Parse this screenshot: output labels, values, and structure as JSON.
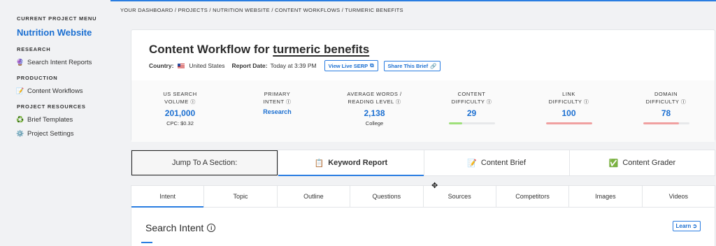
{
  "sidebar": {
    "menu_header": "CURRENT PROJECT MENU",
    "project_name": "Nutrition Website",
    "sections": [
      {
        "title": "RESEARCH",
        "items": [
          {
            "label": "Search Intent Reports",
            "icon": "crystal-ball-icon"
          }
        ]
      },
      {
        "title": "PRODUCTION",
        "items": [
          {
            "label": "Content Workflows",
            "icon": "memo-icon"
          }
        ]
      },
      {
        "title": "PROJECT RESOURCES",
        "items": [
          {
            "label": "Brief Templates",
            "icon": "recycle-icon"
          },
          {
            "label": "Project Settings",
            "icon": "gear-icon"
          }
        ]
      }
    ]
  },
  "breadcrumb": "YOUR DASHBOARD / PROJECTS / NUTRITION WEBSITE / CONTENT WORKFLOWS / TURMERIC BENEFITS",
  "header": {
    "title_prefix": "Content Workflow for",
    "keyword": "turmeric benefits",
    "country_label": "Country:",
    "country_value": "United States",
    "report_date_label": "Report Date:",
    "report_date_value": "Today at 3:39 PM",
    "view_serp_label": "View Live SERP",
    "share_brief_label": "Share This Brief"
  },
  "metrics": [
    {
      "label1": "US SEARCH",
      "label2": "VOLUME",
      "value": "201,000",
      "sub": "CPC: $0.32"
    },
    {
      "label1": "PRIMARY",
      "label2": "INTENT",
      "value": "Research",
      "sub": ""
    },
    {
      "label1": "AVERAGE WORDS /",
      "label2": "READING LEVEL",
      "value": "2,138",
      "sub": "College"
    },
    {
      "label1": "CONTENT",
      "label2": "DIFFICULTY",
      "value": "29",
      "bar_level": 0.29,
      "bar_color": "#9ee07a"
    },
    {
      "label1": "LINK",
      "label2": "DIFFICULTY",
      "value": "100",
      "bar_level": 1.0,
      "bar_color": "#f0a0a0"
    },
    {
      "label1": "DOMAIN",
      "label2": "DIFFICULTY",
      "value": "78",
      "bar_level": 0.78,
      "bar_color": "#f0a0a0"
    }
  ],
  "jump": {
    "label": "Jump To A Section:",
    "tabs": [
      {
        "label": "Keyword Report",
        "icon": "clipboard-icon",
        "emoji": "📋"
      },
      {
        "label": "Content Brief",
        "icon": "memo-icon",
        "emoji": "📝"
      },
      {
        "label": "Content Grader",
        "icon": "check-mark-icon",
        "emoji": "✅"
      }
    ]
  },
  "subtabs": [
    "Intent",
    "Topic",
    "Outline",
    "Questions",
    "Sources",
    "Competitors",
    "Images",
    "Videos"
  ],
  "section": {
    "title": "Search Intent",
    "learn_label": "Learn"
  },
  "colors": {
    "accent": "#1b6fd1"
  }
}
